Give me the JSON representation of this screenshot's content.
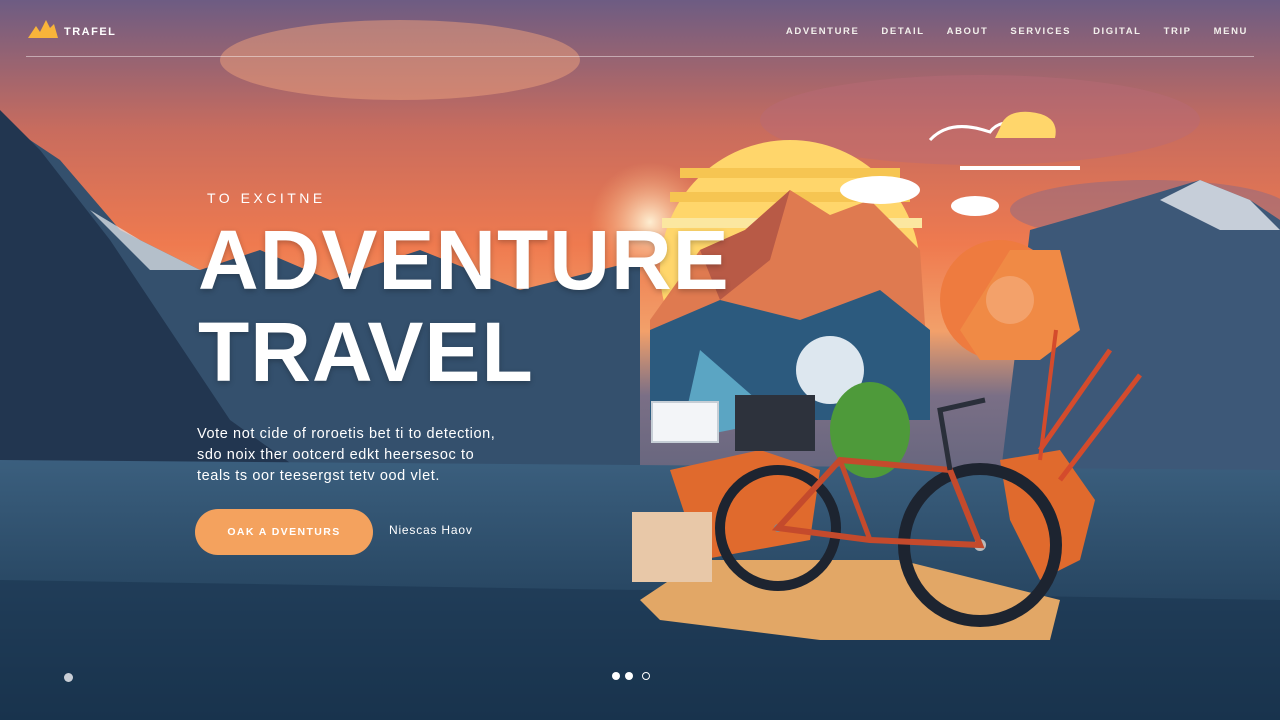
{
  "brand": {
    "name": "TRAFEL",
    "logo_icon": "mountain-logo-icon"
  },
  "nav": {
    "items": [
      "ADVENTURE",
      "DETAIL",
      "ABOUT",
      "SERVICES",
      "DIGITAL",
      "TRIP",
      "MENU"
    ]
  },
  "hero": {
    "eyebrow": "TO EXCITNE",
    "title_line1": "ADVENTURE",
    "title_line2": "TRAVEL",
    "description_lines": [
      "Vote not cide of roroetis bet ti to detection,",
      "sdo noix ther ootcerd edkt heersesoc to",
      "teals ts oor teesergst tetv ood vlet."
    ],
    "cta_label": "OAK A DVENTURS",
    "secondary_label": "Niescas Haov"
  },
  "carousel": {
    "active_index": 0,
    "count": 3
  },
  "colors": {
    "accent": "#f4a25e",
    "sky_top": "#6b5c7e",
    "sunset": "#f07a4e",
    "ground": "#1d3a56"
  }
}
